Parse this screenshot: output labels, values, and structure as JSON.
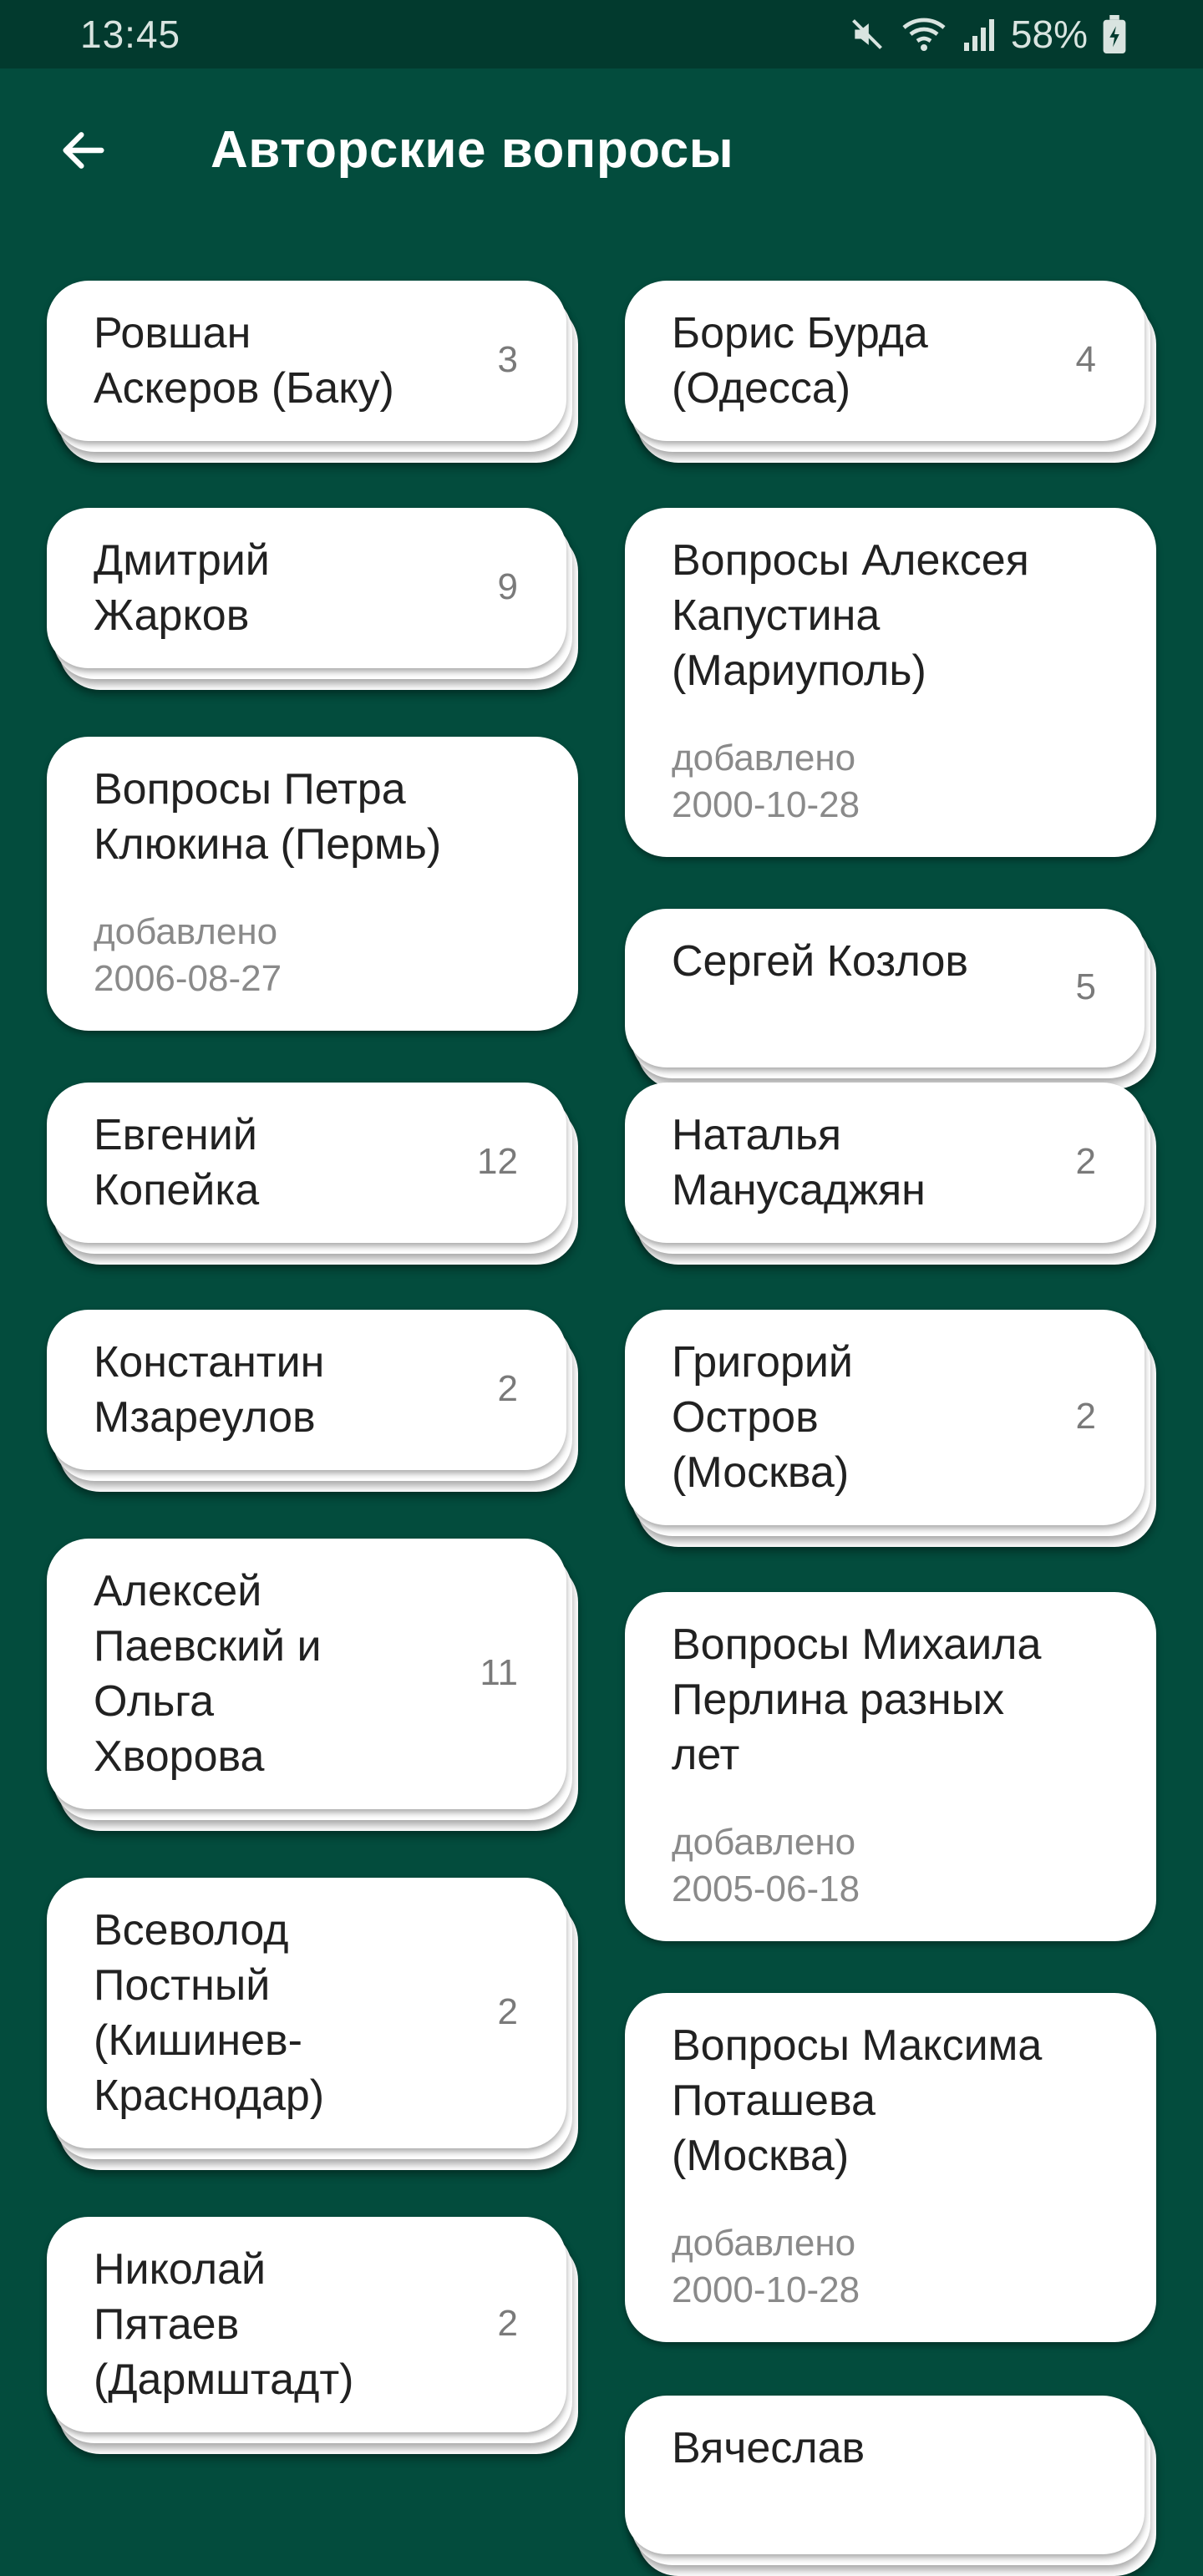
{
  "status_bar": {
    "time": "13:45",
    "battery_percent": "58%",
    "icons": [
      "mute-icon",
      "wifi-icon",
      "signal-icon",
      "battery-icon"
    ]
  },
  "app_bar": {
    "title": "Авторские вопросы",
    "back_icon": "arrow-left-icon"
  },
  "colors": {
    "background": "#034c3d",
    "status_bar": "#023a2e",
    "card": "#ffffff",
    "title_text": "#212121",
    "secondary_text": "#7a7a7a"
  },
  "left_column": [
    {
      "title": "Ровшан Аскеров (Баку)",
      "lines": [
        "Ровшан",
        "Аскеров (Баку)"
      ],
      "count": "3"
    },
    {
      "title": "Дмитрий Жарков",
      "lines": [
        "Дмитрий",
        "Жарков"
      ],
      "count": "9"
    },
    {
      "title": "Вопросы Петра Клюкина (Пермь)",
      "lines": [
        "Вопросы Петра",
        "Клюкина (Пермь)"
      ],
      "date_label": "добавлено",
      "date": "2006-08-27"
    },
    {
      "title": "Евгений Копейка",
      "lines": [
        "Евгений",
        "Копейка"
      ],
      "count": "12"
    },
    {
      "title": "Константин Мзареулов",
      "lines": [
        "Константин",
        "Мзареулов"
      ],
      "count": "2"
    },
    {
      "title": "Алексей Паевский и Ольга Хворова",
      "lines": [
        "Алексей",
        "Паевский и",
        "Ольга",
        "Хворова"
      ],
      "count": "11"
    },
    {
      "title": "Всеволод Постный (Кишинев-Краснодар)",
      "lines": [
        "Всеволод",
        "Постный",
        "(Кишинев-",
        "Краснодар)"
      ],
      "count": "2"
    },
    {
      "title": "Николай Пятаев (Дармштадт)",
      "lines": [
        "Николай",
        "Пятаев",
        "(Дармштадт)"
      ],
      "count": "2"
    }
  ],
  "right_column": [
    {
      "title": "Борис Бурда (Одесса)",
      "lines": [
        "Борис Бурда",
        "(Одесса)"
      ],
      "count": "4"
    },
    {
      "title": "Вопросы Алексея Капустина (Мариуполь)",
      "lines": [
        "Вопросы Алексея",
        "Капустина",
        "(Мариуполь)"
      ],
      "date_label": "добавлено",
      "date": "2000-10-28"
    },
    {
      "title": "Сергей Козлов",
      "lines": [
        "Сергей Козлов"
      ],
      "count": "5"
    },
    {
      "title": "Наталья Манусаджян",
      "lines": [
        "Наталья",
        "Манусаджян"
      ],
      "count": "2"
    },
    {
      "title": "Григорий Остров (Москва)",
      "lines": [
        "Григорий",
        "Остров",
        "(Москва)"
      ],
      "count": "2"
    },
    {
      "title": "Вопросы Михаила Перлина разных лет",
      "lines": [
        "Вопросы Михаила",
        "Перлина разных",
        "лет"
      ],
      "date_label": "добавлено",
      "date": "2005-06-18"
    },
    {
      "title": "Вопросы Максима Поташева (Москва)",
      "lines": [
        "Вопросы Максима",
        "Поташева",
        "(Москва)"
      ],
      "date_label": "добавлено",
      "date": "2000-10-28"
    },
    {
      "title": "Вячеслав",
      "lines": [
        "Вячеслав"
      ],
      "count": ""
    }
  ]
}
